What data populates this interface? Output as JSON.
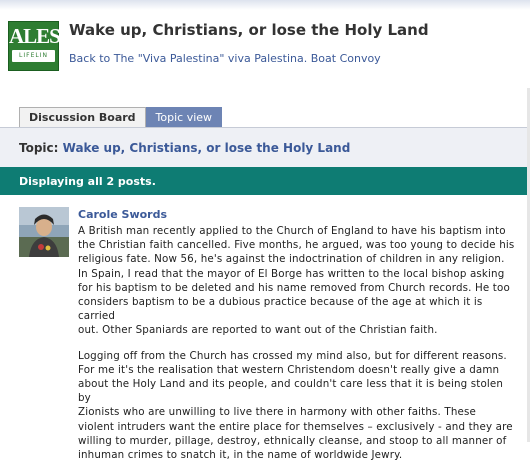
{
  "header": {
    "logo_big": "ALES",
    "logo_small": "LIFELIN",
    "title": "Wake up, Christians, or lose the Holy Land",
    "back_link": "Back to The \"Viva Palestina\" viva Palestina. Boat Convoy"
  },
  "tabs": [
    {
      "label": "Discussion Board",
      "active": false
    },
    {
      "label": "Topic view",
      "active": true
    }
  ],
  "topic": {
    "label": "Topic:",
    "title": "Wake up, Christians, or lose the Holy Land"
  },
  "display_text": "Displaying all 2 posts.",
  "post": {
    "author": "Carole Swords",
    "lines1": [
      "A British man recently applied to the Church of England to have his baptism into",
      "the Christian faith cancelled. Five months, he argued, was too young to decide his",
      "religious fate. Now 56, he's against the indoctrination of children in any religion.",
      "In Spain, I read that the mayor of El Borge has written to the local bishop asking",
      "for his baptism to be deleted and his name removed from Church records. He too",
      "considers baptism to be a dubious practice because of the age at which it is carried",
      "out. Other Spaniards are reported to want out of the Christian faith."
    ],
    "lines2": [
      "Logging off from the Church has crossed my mind also, but for different reasons.",
      "For me it's the realisation that western Christendom doesn't really give a damn",
      "about the Holy Land and its people, and couldn't care less that it is being stolen by",
      "Zionists who are unwilling to live there in harmony with other faiths. These",
      "violent intruders want the entire place for themselves – exclusively - and they are",
      "willing to murder, pillage, destroy, ethnically cleanse, and stoop to all manner of",
      "inhuman crimes to snatch it, in the name of worldwide Jewry."
    ]
  },
  "colors": {
    "link": "#3b5998",
    "tab_active": "#6d84b4",
    "display_bar": "#0e7c73"
  }
}
